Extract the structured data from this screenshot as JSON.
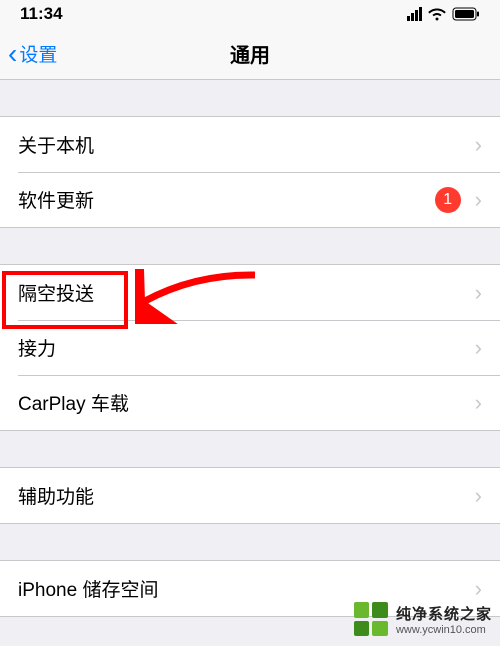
{
  "status": {
    "time": "11:34"
  },
  "nav": {
    "back_label": "设置",
    "title": "通用"
  },
  "sections": [
    {
      "rows": [
        {
          "label": "关于本机"
        },
        {
          "label": "软件更新",
          "badge": "1"
        }
      ]
    },
    {
      "rows": [
        {
          "label": "隔空投送"
        },
        {
          "label": "接力"
        },
        {
          "label": "CarPlay 车载"
        }
      ]
    },
    {
      "rows": [
        {
          "label": "辅助功能"
        }
      ]
    },
    {
      "rows": [
        {
          "label": "iPhone 储存空间"
        }
      ]
    }
  ],
  "watermark": {
    "title": "纯净系统之家",
    "url": "www.ycwin10.com"
  }
}
